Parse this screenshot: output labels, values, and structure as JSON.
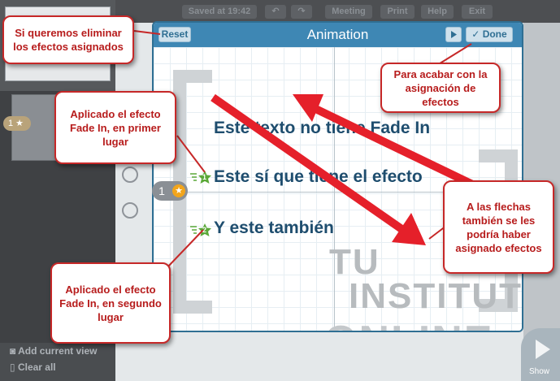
{
  "topbar": {
    "saved": "Saved at 19:42",
    "meeting": "Meeting",
    "print": "Print",
    "help": "Help",
    "exit": "Exit"
  },
  "sidebar": {
    "badge_number": "1",
    "add_view": "Add current view",
    "clear_all": "Clear all"
  },
  "show_label": "Show",
  "dialog": {
    "title": "Animation",
    "reset_label": "Reset",
    "done_label": "Done",
    "play_icon": "play-icon",
    "check_icon": "check-icon"
  },
  "slide": {
    "line1": "Este texto no tiene Fade In",
    "line2": "Este sí que tiene el efecto",
    "line3": "Y este también",
    "badge1": "1",
    "badge2": "2",
    "order_number": "1",
    "watermark": [
      "TU",
      "INSTITUTO",
      "ONLINE"
    ]
  },
  "callouts": {
    "reset_note": "Si queremos eliminar los efectos asignados",
    "done_note": "Para acabar con la asignación de efectos",
    "first_note": "Aplicado el efecto Fade In, en primer lugar",
    "second_note": "Aplicado el efecto Fade In, en segundo lugar",
    "arrows_note": "A las flechas también se les podría haber asignado efectos"
  },
  "colors": {
    "dialog_header": "#3e87b4",
    "slide_text": "#1e4d6e",
    "callout_border": "#c62828",
    "arrow_red": "#e5202a",
    "badge_green": "#5aa838",
    "order_orange": "#f2a51c"
  }
}
